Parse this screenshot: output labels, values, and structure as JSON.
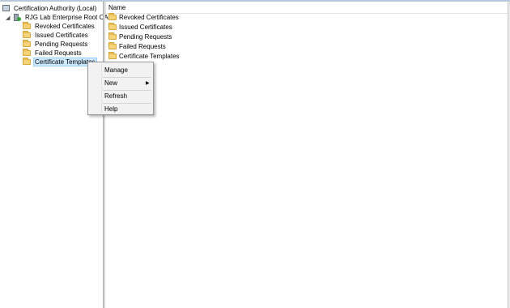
{
  "tree": {
    "root": {
      "label": "Certification Authority (Local)"
    },
    "ca": {
      "expander": "◢",
      "label": "RJG Lab Enterprise Root CA"
    },
    "children": [
      {
        "label": "Revoked Certificates"
      },
      {
        "label": "Issued Certificates"
      },
      {
        "label": "Pending Requests"
      },
      {
        "label": "Failed Requests"
      },
      {
        "label": "Certificate Templates"
      }
    ],
    "selected_index": 4
  },
  "list": {
    "header": {
      "name": "Name"
    },
    "rows": [
      {
        "label": "Revoked Certificates"
      },
      {
        "label": "Issued Certificates"
      },
      {
        "label": "Pending Requests"
      },
      {
        "label": "Failed Requests"
      },
      {
        "label": "Certificate Templates"
      }
    ]
  },
  "context_menu": {
    "items": [
      {
        "label": "Manage"
      },
      {
        "label": "New",
        "submenu_arrow": "▶"
      },
      {
        "label": "Refresh"
      },
      {
        "label": "Help"
      }
    ]
  },
  "icons": {
    "folder": "folder-icon",
    "ca": "certificate-authority-icon",
    "console": "console-icon"
  },
  "colors": {
    "selection_bg": "#cce8ff",
    "selection_border": "#99d1ff",
    "folder": "#f5d37a"
  }
}
